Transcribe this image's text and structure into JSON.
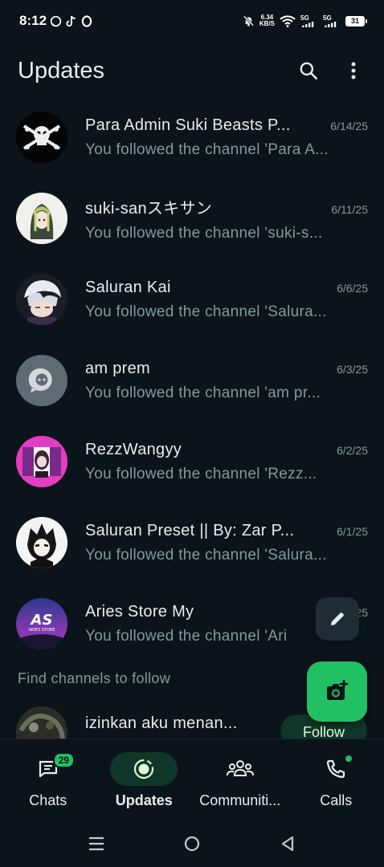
{
  "status_bar": {
    "time": "8:12",
    "net_speed_value": "6.34",
    "net_speed_unit": "KB/S",
    "signal1": "5G",
    "signal2": "5G",
    "battery": "31"
  },
  "header": {
    "title": "Updates"
  },
  "channels": [
    {
      "name": "Para Admin Suki Beasts P...",
      "date": "6/14/25",
      "subtitle": "You followed the channel 'Para A..."
    },
    {
      "name": "suki-sanスキサン",
      "date": "6/11/25",
      "subtitle": "You followed the channel 'suki-s..."
    },
    {
      "name": "Saluran Kai",
      "date": "6/6/25",
      "subtitle": "You followed the channel 'Salura..."
    },
    {
      "name": "am prem",
      "date": "6/3/25",
      "subtitle": "You followed the channel 'am pr..."
    },
    {
      "name": "RezzWangyy",
      "date": "6/2/25",
      "subtitle": "You followed the channel 'Rezz..."
    },
    {
      "name": "Saluran Preset || By: Zar P...",
      "date": "6/1/25",
      "subtitle": "You followed the channel 'Salura..."
    },
    {
      "name": "Aries Store My",
      "date": "25",
      "subtitle": "You followed the channel 'Ari"
    }
  ],
  "find_channels": {
    "label": "Find channels to follow",
    "suggestion_name": "izinkan aku menan...",
    "follow_label": "Follow"
  },
  "nav": {
    "chats_label": "Chats",
    "chats_badge": "29",
    "updates_label": "Updates",
    "communities_label": "Communiti...",
    "calls_label": "Calls"
  },
  "colors": {
    "background": "#0b141a",
    "accent": "#21c063",
    "active_pill": "#103529",
    "secondary_text": "#8696a0"
  },
  "icons": [
    "whatsapp-icon",
    "tiktok-icon",
    "opera-icon",
    "mute-icon",
    "wifi-icon",
    "signal-icon",
    "battery-icon",
    "search-icon",
    "more-vert-icon",
    "pencil-icon",
    "camera-add-icon",
    "chats-icon",
    "updates-icon",
    "communities-icon",
    "calls-icon"
  ]
}
